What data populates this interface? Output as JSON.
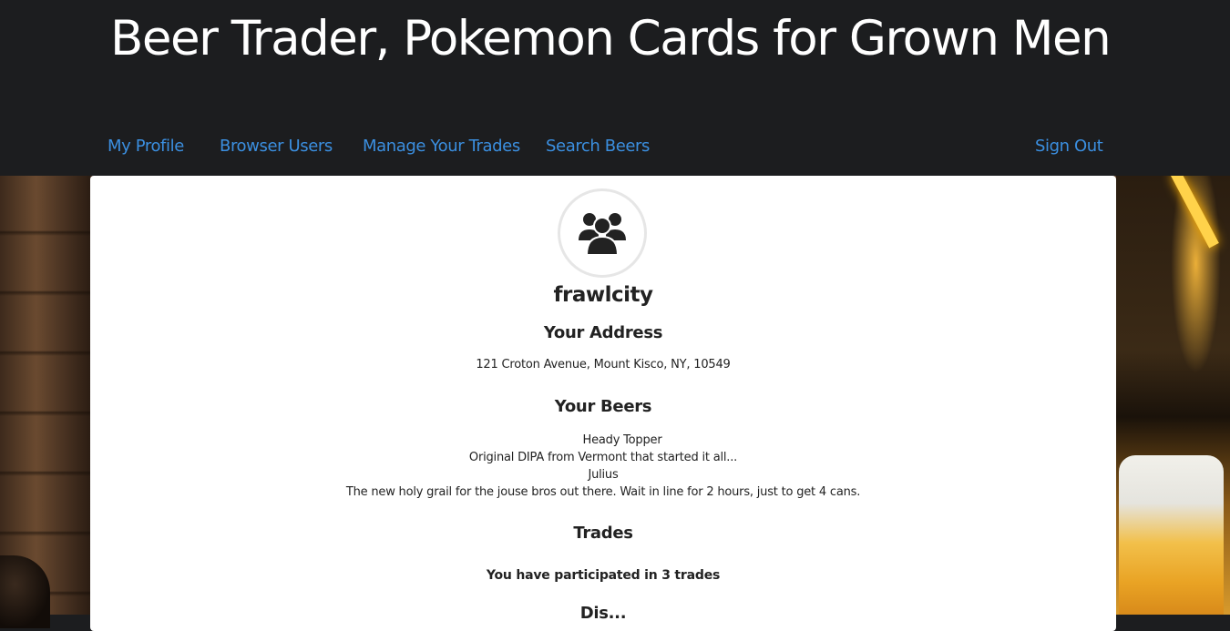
{
  "header": {
    "title": "Beer Trader, Pokemon Cards for Grown Men"
  },
  "nav": {
    "items": [
      {
        "label": "My Profile"
      },
      {
        "label": "Browser Users"
      },
      {
        "label": "Manage Your Trades"
      },
      {
        "label": "Search Beers"
      }
    ],
    "sign_out": "Sign Out"
  },
  "profile": {
    "avatar_icon": "users-group-icon",
    "username": "frawlcity",
    "address_heading": "Your Address",
    "address": "121 Croton Avenue, Mount Kisco, NY, 10549",
    "beers_heading": "Your Beers",
    "beers": [
      {
        "name": "Heady Topper",
        "description": "Original DIPA from Vermont that started it all..."
      },
      {
        "name": "Julius",
        "description": "The new holy grail for the jouse bros out there. Wait in line for 2 hours, just to get 4 cans."
      }
    ],
    "trades_heading": "Trades",
    "trades_summary": "You have participated in 3 trades",
    "next_heading_partial": "Dis..."
  },
  "colors": {
    "header_bg": "#1c1d1f",
    "nav_link": "#3b8fe0",
    "card_bg": "#ffffff"
  }
}
